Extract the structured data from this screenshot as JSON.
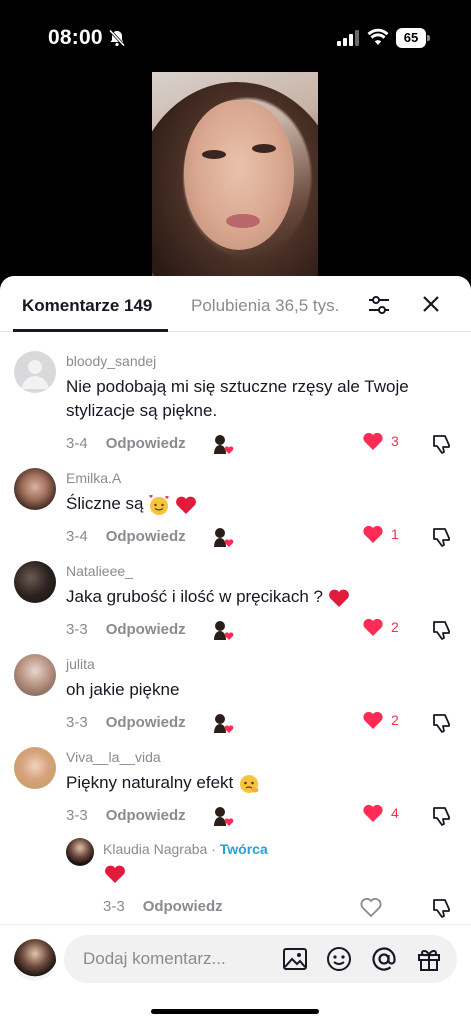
{
  "status_bar": {
    "time": "08:00",
    "battery": "65"
  },
  "tabs": {
    "comments": "Komentarze 149",
    "likes": "Polubienia 36,5 tys."
  },
  "comments": [
    {
      "username": "bloody_sandej",
      "text_line1": "Nie podobają mi się sztuczne rzęsy ale Twoje",
      "text_line2": "stylizacje są piękne.",
      "date": "3-4",
      "reply": "Odpowiedz",
      "likes": "3"
    },
    {
      "username": "Emilka.A",
      "text": "Śliczne są",
      "date": "3-4",
      "reply": "Odpowiedz",
      "likes": "1"
    },
    {
      "username": "Natalieee_",
      "text": "Jaka grubość i ilość w pręcikach ?",
      "date": "3-3",
      "reply": "Odpowiedz",
      "likes": "2"
    },
    {
      "username": "julita",
      "text": "oh jakie piękne",
      "date": "3-3",
      "reply": "Odpowiedz",
      "likes": "2"
    },
    {
      "username": "Viva__la__vida",
      "text": "Piękny naturalny efekt",
      "date": "3-3",
      "reply": "Odpowiedz",
      "likes": "4"
    }
  ],
  "reply": {
    "username": "Klaudia Nagraba",
    "tag": "Twórca",
    "date": "3-3",
    "reply": "Odpowiedz"
  },
  "composer": {
    "placeholder": "Dodaj komentarz..."
  },
  "colors": {
    "like": "#fe2c55",
    "creator": "#25a3d6",
    "text": "#161823",
    "muted": "#8a8b91"
  }
}
